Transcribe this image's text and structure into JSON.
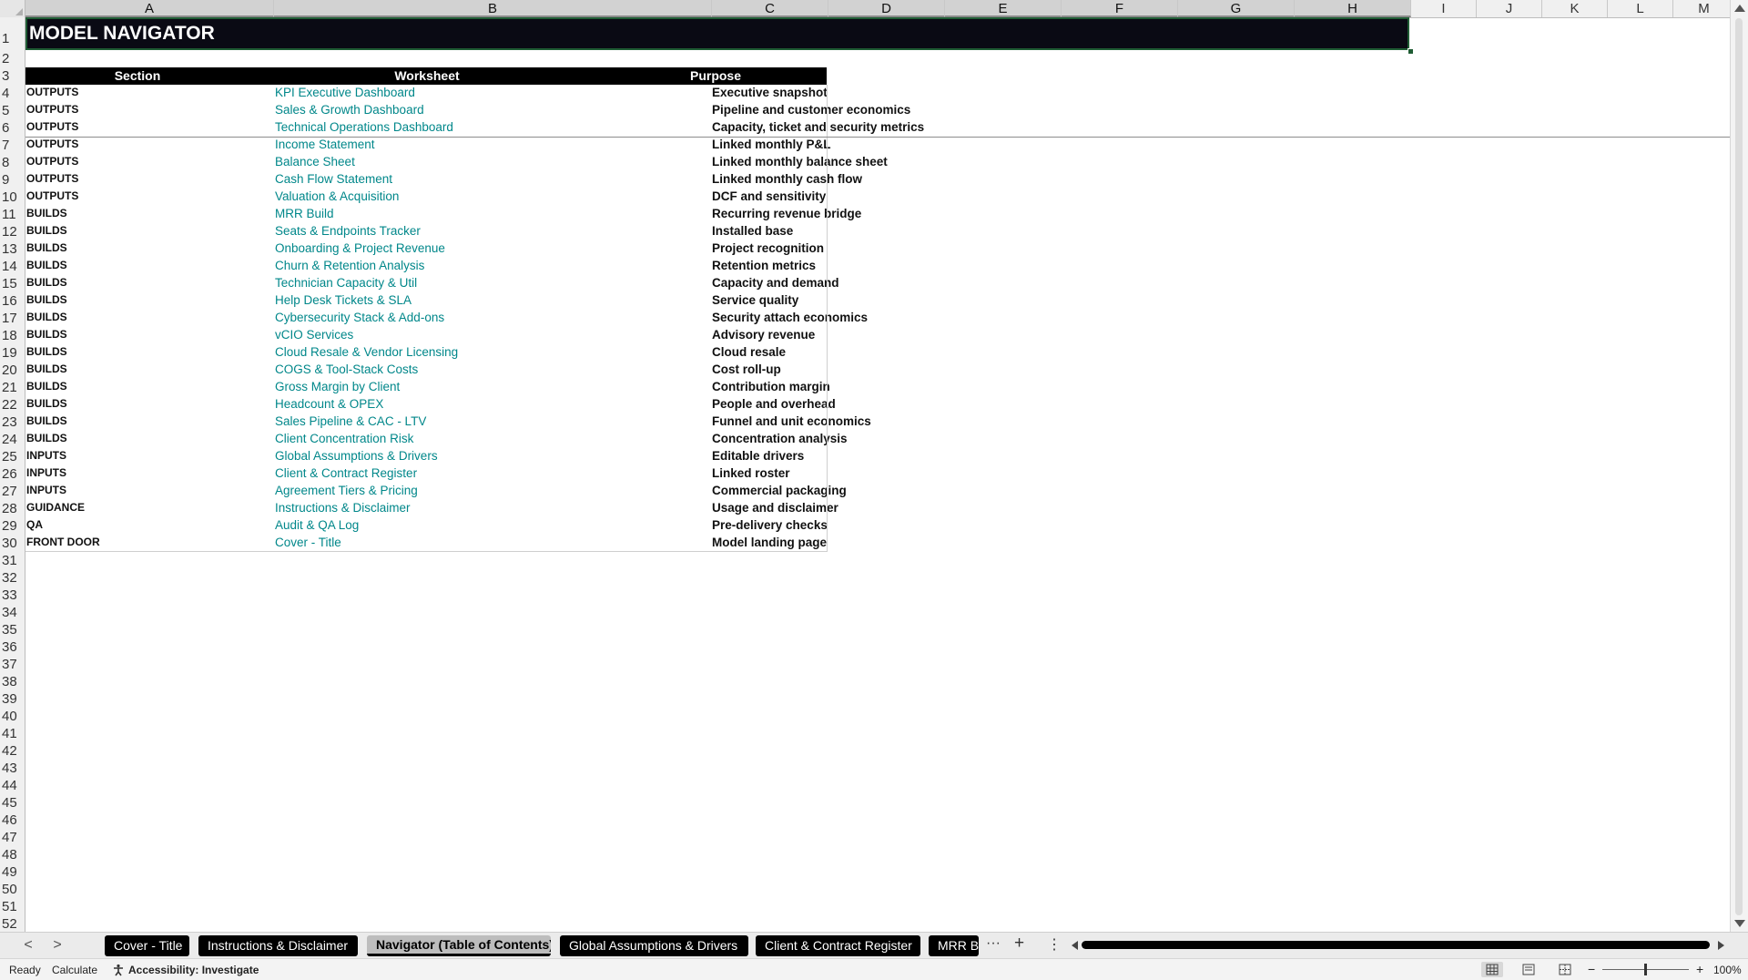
{
  "columns": [
    "A",
    "B",
    "C",
    "D",
    "E",
    "F",
    "G",
    "H",
    "I",
    "J",
    "K",
    "L",
    "M"
  ],
  "rows": [
    "1",
    "2",
    "3",
    "4",
    "5",
    "6",
    "7",
    "8",
    "9",
    "10",
    "11",
    "12",
    "13",
    "14",
    "15",
    "16",
    "17",
    "18",
    "19",
    "20",
    "21",
    "22",
    "23",
    "24",
    "25",
    "26",
    "27",
    "28",
    "29",
    "30",
    "31",
    "32",
    "33",
    "34",
    "35",
    "36",
    "37",
    "38",
    "39",
    "40",
    "41",
    "42",
    "43",
    "44",
    "45",
    "46",
    "47",
    "48",
    "49",
    "50",
    "51",
    "52"
  ],
  "title": "MODEL NAVIGATOR",
  "table": {
    "headers": {
      "section": "Section",
      "worksheet": "Worksheet",
      "purpose": "Purpose"
    },
    "rows": [
      {
        "section": "OUTPUTS",
        "worksheet": "KPI Executive Dashboard",
        "purpose": "Executive snapshot"
      },
      {
        "section": "OUTPUTS",
        "worksheet": "Sales & Growth Dashboard",
        "purpose": "Pipeline and customer economics"
      },
      {
        "section": "OUTPUTS",
        "worksheet": "Technical Operations Dashboard",
        "purpose": "Capacity, ticket and security metrics"
      },
      {
        "section": "OUTPUTS",
        "worksheet": "Income Statement",
        "purpose": "Linked monthly P&L"
      },
      {
        "section": "OUTPUTS",
        "worksheet": "Balance Sheet",
        "purpose": "Linked monthly balance sheet"
      },
      {
        "section": "OUTPUTS",
        "worksheet": "Cash Flow Statement",
        "purpose": "Linked monthly cash flow"
      },
      {
        "section": "OUTPUTS",
        "worksheet": "Valuation & Acquisition",
        "purpose": "DCF and sensitivity"
      },
      {
        "section": "BUILDS",
        "worksheet": "MRR Build",
        "purpose": "Recurring revenue bridge"
      },
      {
        "section": "BUILDS",
        "worksheet": "Seats & Endpoints Tracker",
        "purpose": "Installed base"
      },
      {
        "section": "BUILDS",
        "worksheet": "Onboarding & Project Revenue",
        "purpose": "Project recognition"
      },
      {
        "section": "BUILDS",
        "worksheet": "Churn & Retention Analysis",
        "purpose": "Retention metrics"
      },
      {
        "section": "BUILDS",
        "worksheet": "Technician Capacity & Util",
        "purpose": "Capacity and demand"
      },
      {
        "section": "BUILDS",
        "worksheet": "Help Desk Tickets & SLA",
        "purpose": "Service quality"
      },
      {
        "section": "BUILDS",
        "worksheet": "Cybersecurity Stack & Add-ons",
        "purpose": "Security attach economics"
      },
      {
        "section": "BUILDS",
        "worksheet": "vCIO Services",
        "purpose": "Advisory revenue"
      },
      {
        "section": "BUILDS",
        "worksheet": "Cloud Resale & Vendor Licensing",
        "purpose": "Cloud resale"
      },
      {
        "section": "BUILDS",
        "worksheet": "COGS & Tool-Stack Costs",
        "purpose": "Cost roll-up"
      },
      {
        "section": "BUILDS",
        "worksheet": "Gross Margin by Client",
        "purpose": "Contribution margin"
      },
      {
        "section": "BUILDS",
        "worksheet": "Headcount & OPEX",
        "purpose": "People and overhead"
      },
      {
        "section": "BUILDS",
        "worksheet": "Sales Pipeline & CAC - LTV",
        "purpose": "Funnel and unit economics"
      },
      {
        "section": "BUILDS",
        "worksheet": "Client Concentration Risk",
        "purpose": "Concentration analysis"
      },
      {
        "section": "INPUTS",
        "worksheet": "Global Assumptions & Drivers",
        "purpose": "Editable drivers"
      },
      {
        "section": "INPUTS",
        "worksheet": "Client & Contract Register",
        "purpose": "Linked roster"
      },
      {
        "section": "INPUTS",
        "worksheet": "Agreement Tiers & Pricing",
        "purpose": "Commercial packaging"
      },
      {
        "section": "GUIDANCE",
        "worksheet": "Instructions & Disclaimer",
        "purpose": "Usage and disclaimer"
      },
      {
        "section": "QA",
        "worksheet": "Audit & QA Log",
        "purpose": "Pre-delivery checks"
      },
      {
        "section": "FRONT DOOR",
        "worksheet": "Cover - Title",
        "purpose": "Model landing page"
      }
    ]
  },
  "sheet_tabs": {
    "items": [
      "Cover - Title",
      "Instructions & Disclaimer",
      "Navigator (Table of Contents)",
      "Global Assumptions & Drivers",
      "Client & Contract Register",
      "MRR Bu"
    ],
    "active": "Navigator (Table of Contents)",
    "prev_icon": "<",
    "next_icon": ">",
    "more_icon": "···",
    "add_icon": "+",
    "options_icon": "⋮"
  },
  "status": {
    "ready": "Ready",
    "calculate": "Calculate",
    "accessibility": "Accessibility: Investigate",
    "zoom_minus": "−",
    "zoom_plus": "+",
    "zoom": "100%"
  }
}
